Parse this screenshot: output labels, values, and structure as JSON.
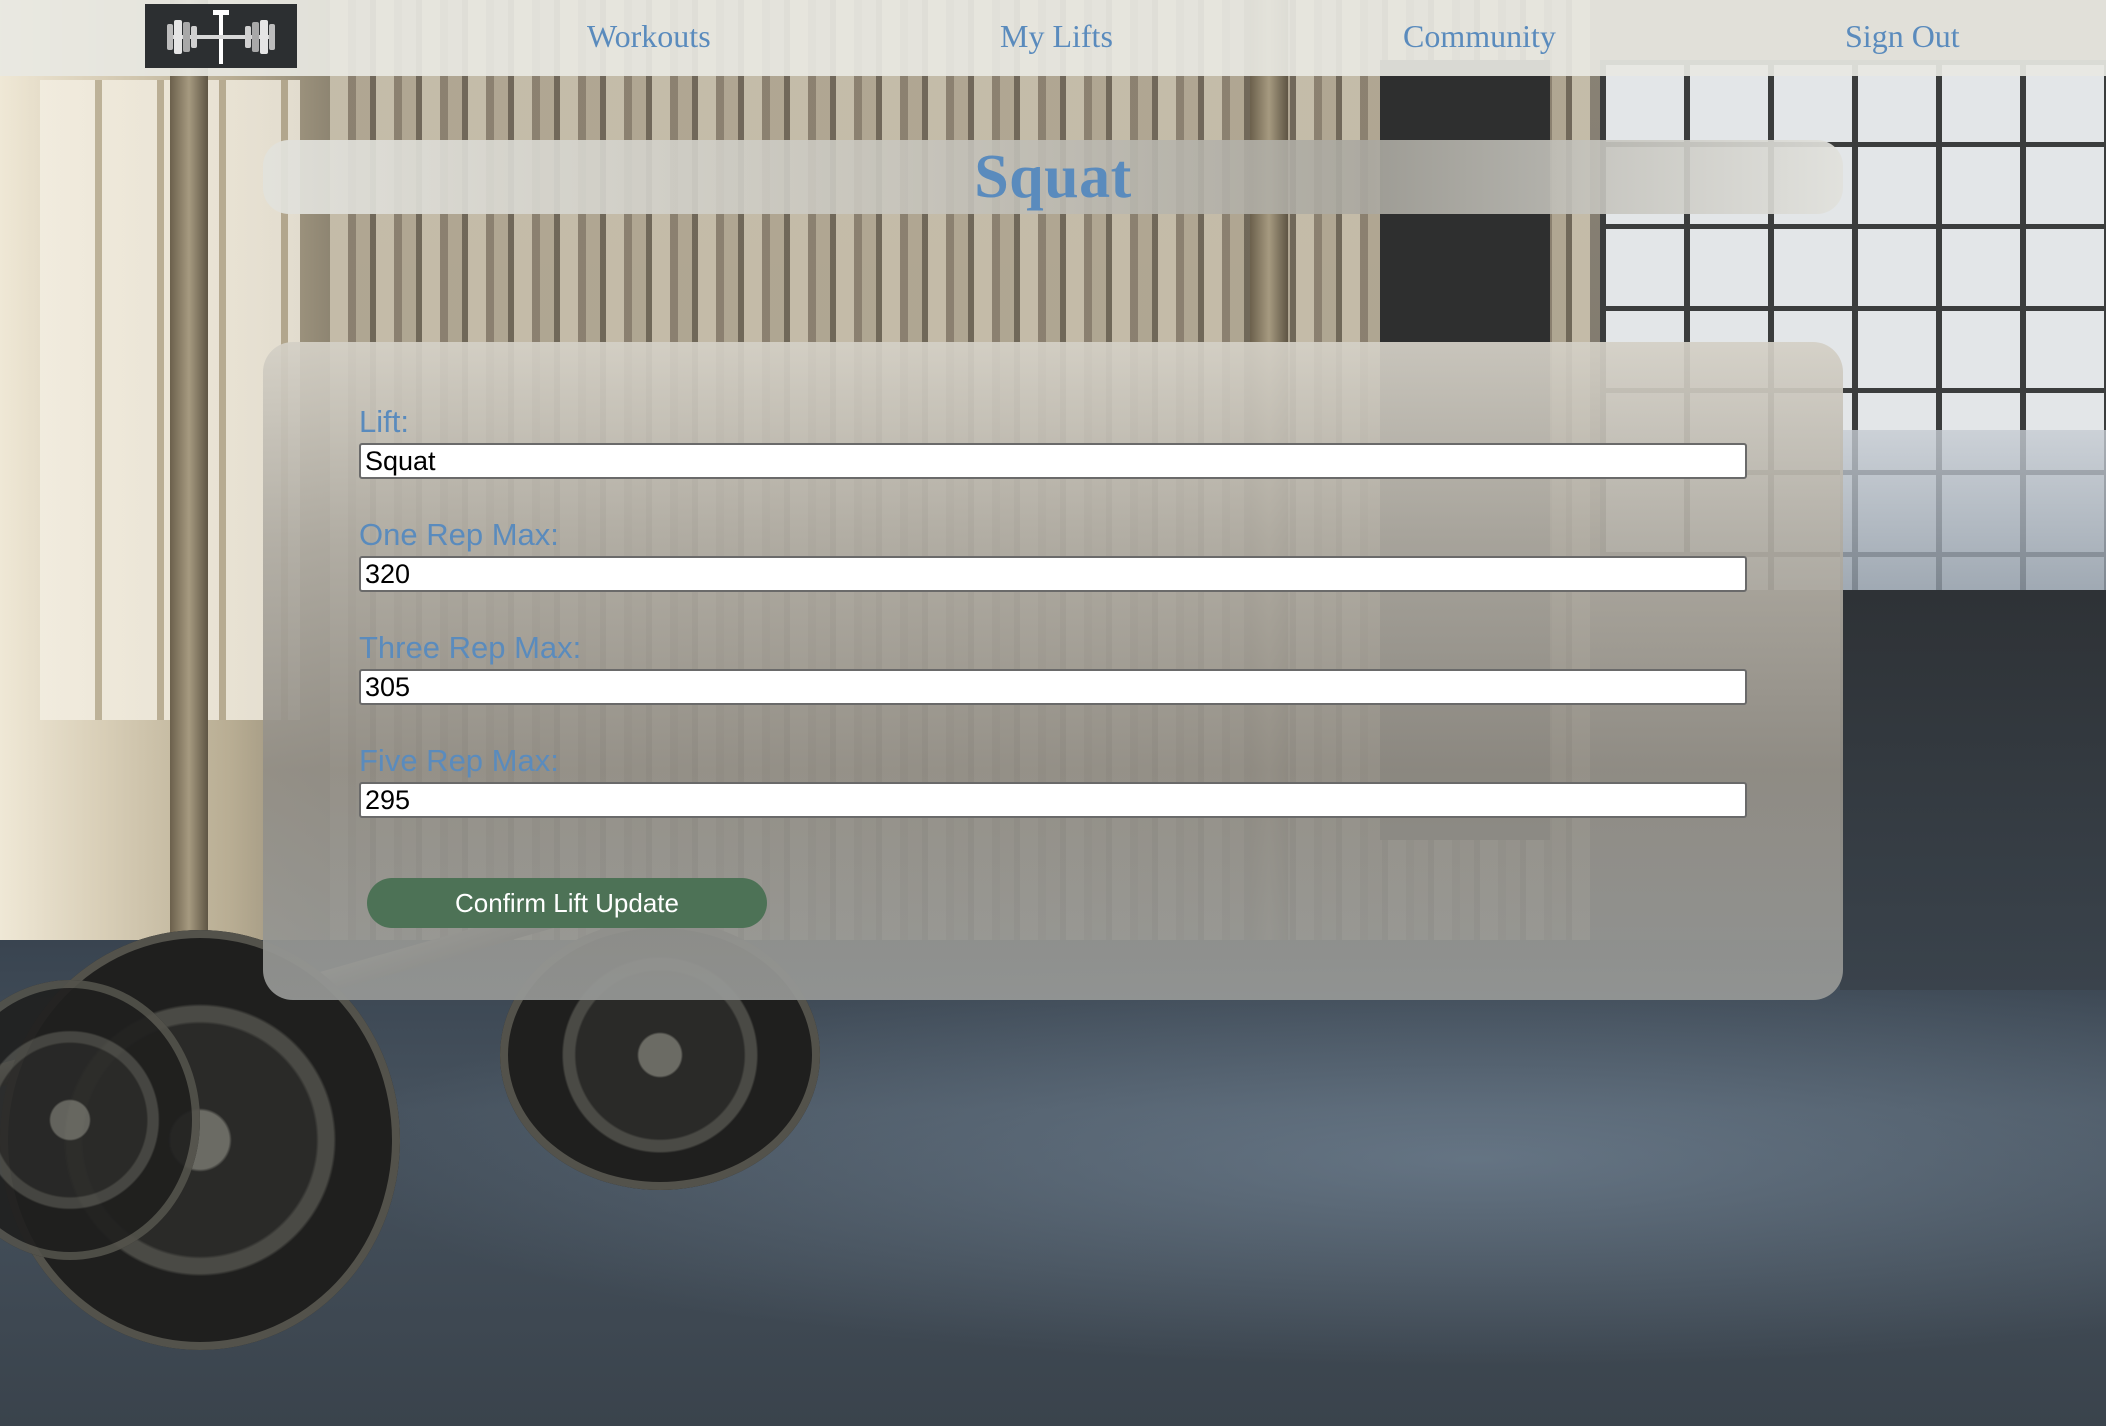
{
  "nav": {
    "logo_icon": "barbell-icon",
    "links": [
      "Workouts",
      "My Lifts",
      "Community",
      "Sign Out"
    ]
  },
  "title": "Squat",
  "form": {
    "fields": [
      {
        "label": "Lift:",
        "value": "Squat"
      },
      {
        "label": "One Rep Max:",
        "value": "320"
      },
      {
        "label": "Three Rep Max:",
        "value": "305"
      },
      {
        "label": "Five Rep Max:",
        "value": "295"
      }
    ],
    "submit_label": "Confirm Lift Update"
  },
  "colors": {
    "accent_text": "#5a8bbd",
    "button": "#4d7256",
    "logo_bg": "#2c2f31"
  }
}
